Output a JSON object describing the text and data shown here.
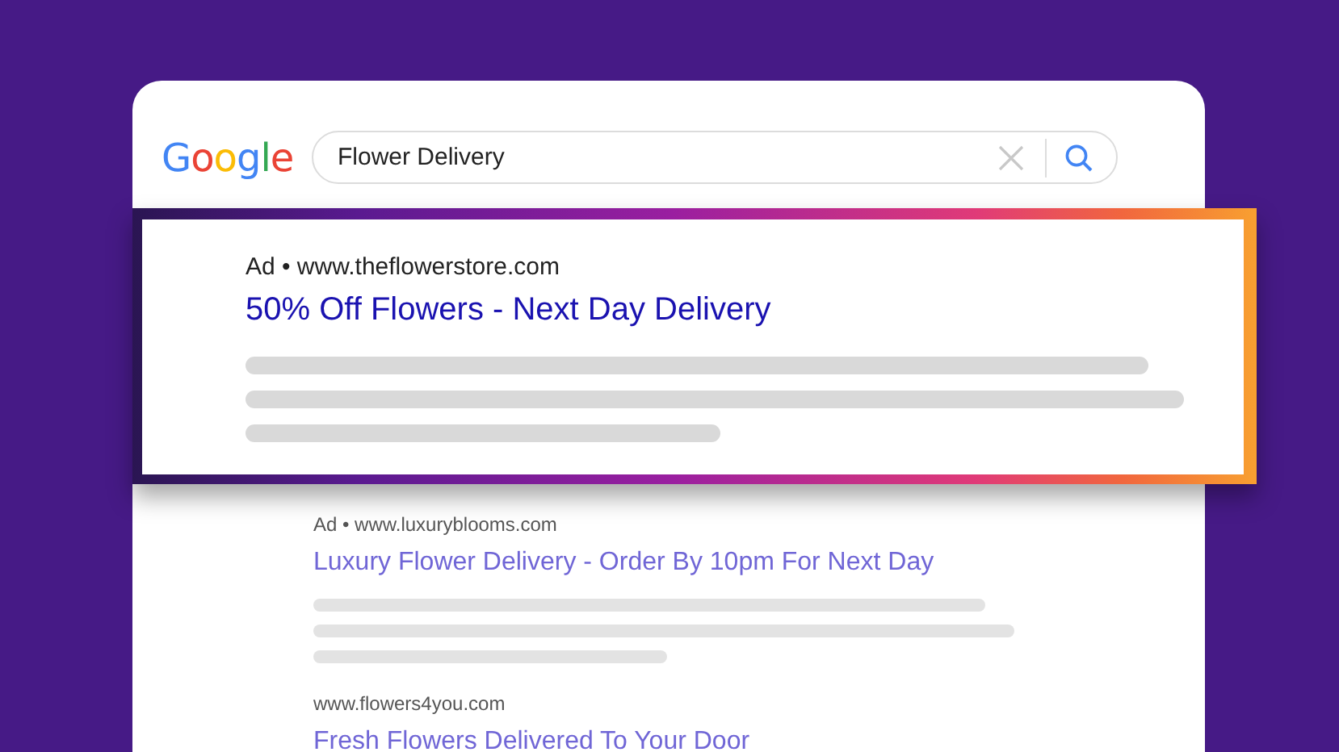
{
  "logo": "Google",
  "search": {
    "value": "Flower Delivery"
  },
  "results": [
    {
      "source": "Ad • www.theflowerstore.com",
      "title": "50% Off Flowers - Next Day Delivery",
      "highlighted": true,
      "snippet_shown": true
    },
    {
      "source": "Ad • www.luxuryblooms.com",
      "title": "Luxury Flower Delivery - Order By 10pm For Next Day",
      "highlighted": false,
      "snippet_shown": true
    },
    {
      "source": "www.flowers4you.com",
      "title": "Fresh Flowers Delivered To Your Door",
      "highlighted": false,
      "snippet_shown": false
    }
  ]
}
